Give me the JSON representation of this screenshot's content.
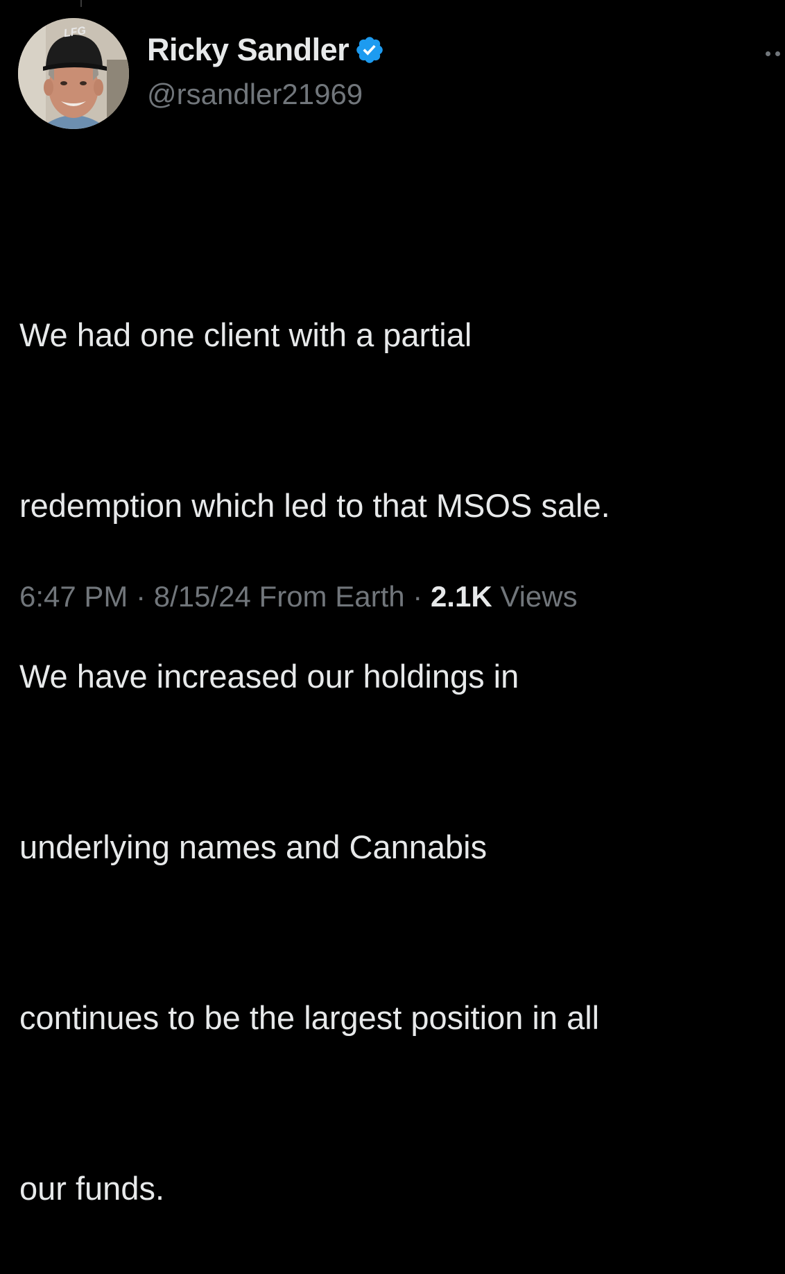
{
  "author": {
    "display_name": "Ricky Sandler",
    "handle": "@rsandler21969",
    "verified_icon": "verified-badge-icon",
    "avatar": {
      "cap_text": "LFG"
    }
  },
  "tweet": {
    "text_lines": [
      "We had one client with a partial",
      "redemption which led to that MSOS sale.",
      "We have increased our holdings in",
      "underlying names and Cannabis",
      "continues to be the largest position in all",
      "our funds."
    ]
  },
  "meta": {
    "time": "6:47 PM",
    "separator1": " · ",
    "date": "8/15/24",
    "location": " From Earth",
    "separator2": " · ",
    "views_count": "2.1K",
    "views_label": " Views"
  },
  "colors": {
    "background": "#000000",
    "primary_text": "#e7e9ea",
    "secondary_text": "#71767b",
    "verified_blue": "#1d9bf0"
  }
}
